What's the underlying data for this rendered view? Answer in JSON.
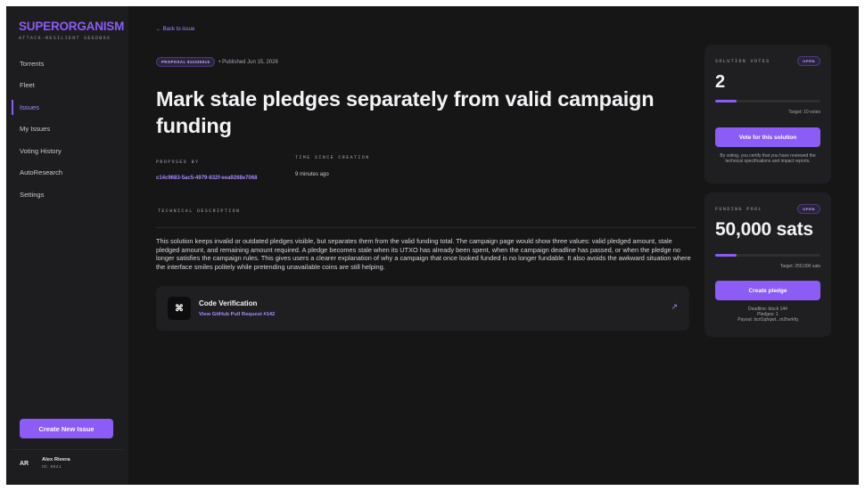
{
  "brand": {
    "title": "SUPERORGANISM",
    "subtitle": "ATTACK-RESILIENT SEEDBOX"
  },
  "sidebar": {
    "items": [
      {
        "label": "Torrents",
        "active": false
      },
      {
        "label": "Fleet",
        "active": false
      },
      {
        "label": "Issues",
        "active": true
      },
      {
        "label": "My Issues",
        "active": false
      },
      {
        "label": "Voting History",
        "active": false
      },
      {
        "label": "AutoResearch",
        "active": false
      },
      {
        "label": "Settings",
        "active": false
      }
    ],
    "create_button": "Create New Issue",
    "user": {
      "initials": "AR",
      "name": "Alex Rivera",
      "id": "ID: 8821"
    }
  },
  "main": {
    "back_link": "← Back to issue",
    "proposal_badge": "PROPOSAL 8110350c5",
    "published": "• Published Jun 15, 2026",
    "title": "Mark stale pledges separately from valid campaign funding",
    "proposed_by_label": "PROPOSED BY",
    "proposer_id": "c14c9683-5ac5-4979-832f-eea9268e7068",
    "time_label": "TIME SINCE CREATION",
    "time_value": "9 minutes ago",
    "technical_label": "TECHNICAL DESCRIPTION",
    "description": "This solution keeps invalid or outdated pledges visible, but separates them from the valid funding total. The campaign page would show three values: valid pledged amount, stale pledged amount, and remaining amount required. A pledge becomes stale when its UTXO has already been spent, when the campaign deadline has passed, or when the pledge no longer satisfies the campaign rules. This gives users a clearer explanation of why a campaign that once looked funded is no longer fundable. It also avoids the awkward situation where the interface smiles politely while pretending unavailable coins are still helping.",
    "code_card": {
      "icon_glyph": "⌘",
      "title": "Code Verification",
      "link": "View GitHub Pull Request #142",
      "arrow_glyph": "↗"
    }
  },
  "votes": {
    "label": "SOLUTION VOTES",
    "badge": "OPEN",
    "count": "2",
    "progress": 0.2,
    "target": "Target: 10 votes",
    "button": "Vote for this solution",
    "disclaimer": "By voting, you certify that you have reviewed the technical specifications and impact reports."
  },
  "funding": {
    "label": "FUNDING POOL",
    "badge": "OPEN",
    "amount": "50,000 sats",
    "progress": 0.2,
    "target": "Target: 250,000 sats",
    "button": "Create pledge",
    "deadline": "Deadline: block 144",
    "pledges": "Pledges: 1",
    "payout": "Payout: bcrt1qhqwt...m2hvrkfq"
  },
  "colors": {
    "accent": "#8b5cf6",
    "accent_text": "#a78bfa",
    "background": "#161617",
    "sidebar": "#1d1d1f",
    "card": "#1f1f21"
  }
}
